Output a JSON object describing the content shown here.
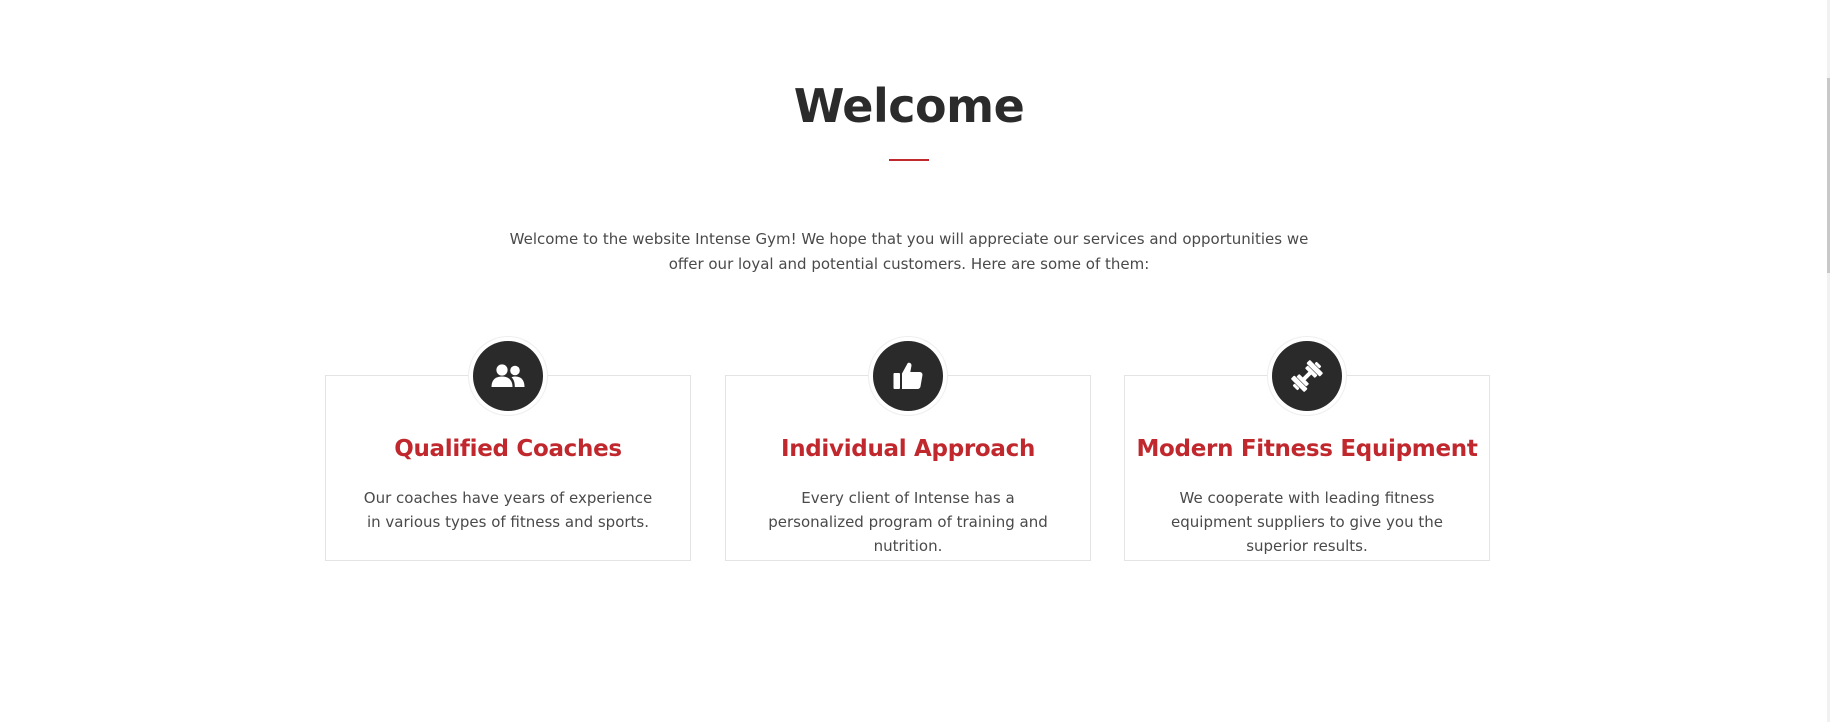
{
  "welcome": {
    "title": "Welcome",
    "intro": "Welcome to the website Intense Gym! We hope that you will appreciate our services and opportunities we offer our loyal and potential customers. Here are some of them:"
  },
  "features": [
    {
      "icon": "users-icon",
      "title": "Qualified Coaches",
      "text": "Our coaches have years of experience in various types of fitness and sports."
    },
    {
      "icon": "thumbs-up-icon",
      "title": "Individual Approach",
      "text": "Every client of Intense has a personalized program of training and nutrition."
    },
    {
      "icon": "dumbbell-icon",
      "title": "Modern Fitness Equipment",
      "text": "We cooperate with leading fitness equipment suppliers to give you the superior results."
    }
  ],
  "colors": {
    "accent": "#c0282d",
    "heading": "#2b2b2b",
    "body_text": "#4a4a4a",
    "icon_bg": "#2a2a2a",
    "card_border": "#e4e4e4"
  }
}
